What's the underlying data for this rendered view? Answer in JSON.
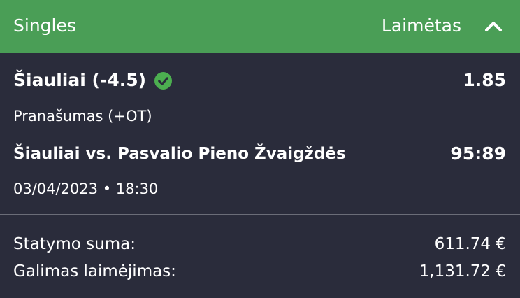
{
  "header": {
    "title": "Singles",
    "status": "Laimėtas",
    "color": "#4a9e56"
  },
  "bet": {
    "selection": "Šiauliai (-4.5)",
    "odds": "1.85",
    "market": "Pranašumas (+OT)",
    "event": "Šiauliai vs. Pasvalio Pieno Žvaigždės",
    "score": "95:89",
    "datetime": "03/04/2023 • 18:30",
    "status_icon": "check-circle-icon",
    "status_color": "#4caf50"
  },
  "summary": {
    "stake_label": "Statymo suma:",
    "stake_value": "611.74 €",
    "win_label": "Galimas laimėjimas:",
    "win_value": "1,131.72 €"
  }
}
